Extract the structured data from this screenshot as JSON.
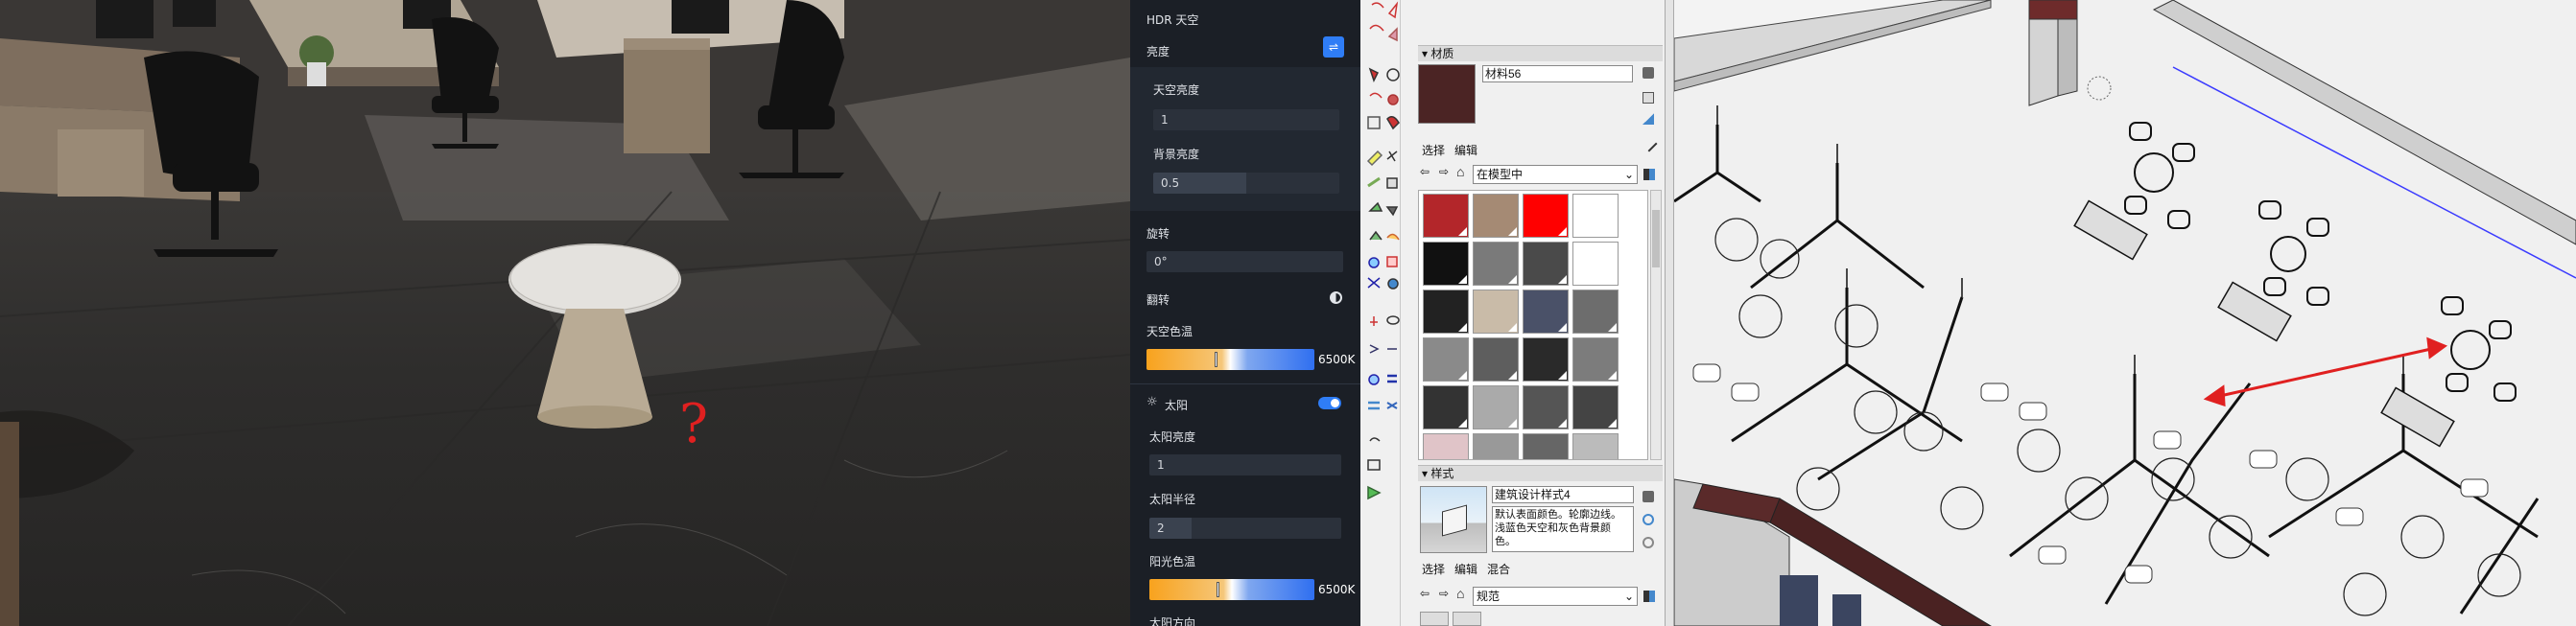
{
  "render_view": {
    "annotation": "?"
  },
  "hdr_panel": {
    "title": "HDR 天空",
    "brightness_label": "亮度",
    "sky_brightness_label": "天空亮度",
    "sky_brightness_value": "1",
    "bg_brightness_label": "背景亮度",
    "bg_brightness_value": "0.5",
    "rotation_label": "旋转",
    "rotation_value": "0°",
    "flip_label": "翻转",
    "sky_color_temp_label": "天空色温",
    "sky_color_temp_value": "6500K",
    "sun_label": "太阳",
    "sun_enabled": true,
    "sun_brightness_label": "太阳亮度",
    "sun_brightness_value": "1",
    "sun_radius_label": "太阳半径",
    "sun_radius_value": "2",
    "sunlight_color_temp_label": "阳光色温",
    "sunlight_color_temp_value": "6500K",
    "sun_direction_label": "太阳方向"
  },
  "materials_panel": {
    "header": "材质",
    "material_name": "材料56",
    "current_color": "#4b2424",
    "tabs": [
      "选择",
      "编辑"
    ],
    "library_select": "在模型中",
    "swatches": [
      "#b3262a",
      "#a58a74",
      "#ff0000",
      "#ffffff",
      "#111111",
      "#7a7a7a",
      "#4a4a4a",
      "#ffffff",
      "#222222",
      "#c9bba8",
      "#4a5168",
      "#6d6d6d",
      "#8a8a8a",
      "#5e5e5e",
      "#2a2a2a",
      "#7c7c7c",
      "#333333",
      "#aaaaaa",
      "#555555",
      "#444444",
      "#e0c4c8",
      "#999999",
      "#666666",
      "#bbbbbb"
    ]
  },
  "styles_panel": {
    "header": "样式",
    "style_name": "建筑设计样式4",
    "style_description": "默认表面颜色。轮廓边线。浅蓝色天空和灰色背景颜色。",
    "tabs": [
      "选择",
      "编辑",
      "混合"
    ],
    "library_select": "规范"
  }
}
